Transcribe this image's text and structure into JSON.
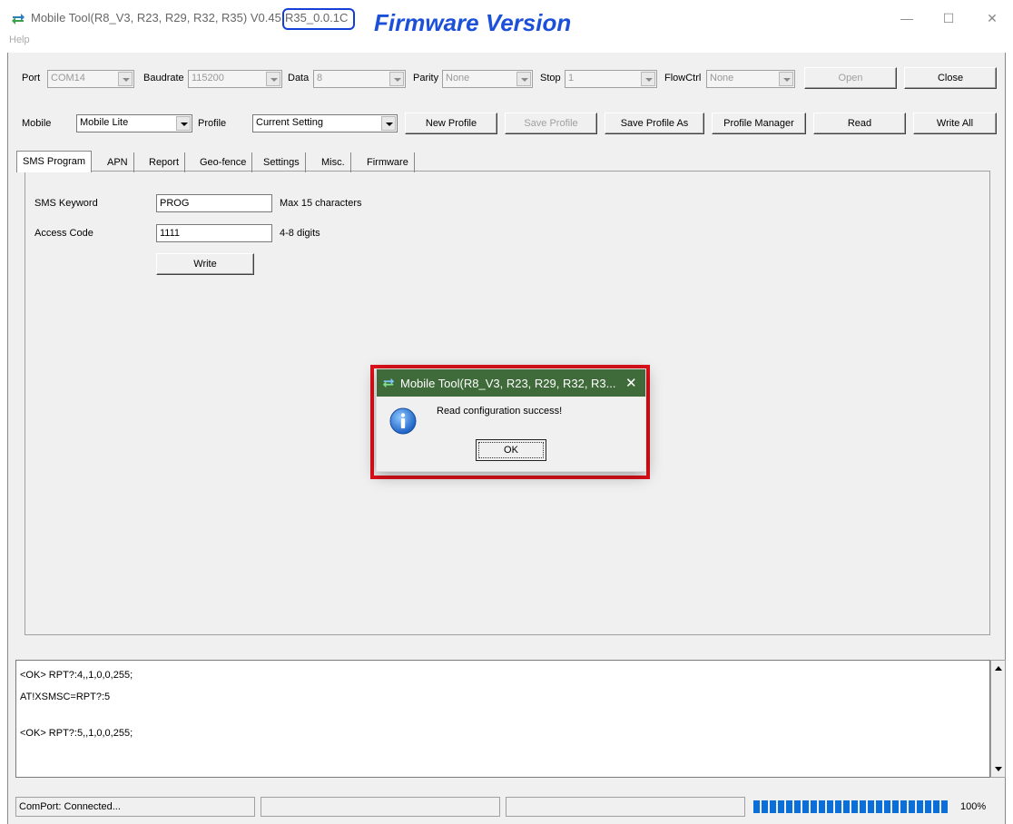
{
  "window": {
    "title": "Mobile Tool(R8_V3, R23, R29, R32, R35) V0.45",
    "firmware_version": "R35_0.0.1C",
    "annotation_label": "Firmware Version",
    "min_glyph": "—",
    "max_glyph": "☐",
    "close_glyph": "✕"
  },
  "menu": {
    "help": "Help"
  },
  "connection": {
    "port_label": "Port",
    "port_value": "COM14",
    "baudrate_label": "Baudrate",
    "baudrate_value": "115200",
    "data_label": "Data",
    "data_value": "8",
    "parity_label": "Parity",
    "parity_value": "None",
    "stop_label": "Stop",
    "stop_value": "1",
    "flowctrl_label": "FlowCtrl",
    "flowctrl_value": "None",
    "open_label": "Open",
    "close_label": "Close"
  },
  "profile_bar": {
    "mobile_label": "Mobile",
    "mobile_value": "Mobile Lite",
    "profile_label": "Profile",
    "profile_value": "Current Setting",
    "new_profile": "New Profile",
    "save_profile": "Save Profile",
    "save_profile_as": "Save Profile As",
    "profile_manager": "Profile Manager",
    "read": "Read",
    "write_all": "Write All"
  },
  "tabs": [
    {
      "label": "SMS Program"
    },
    {
      "label": "APN"
    },
    {
      "label": "Report"
    },
    {
      "label": "Geo-fence"
    },
    {
      "label": "Settings"
    },
    {
      "label": "Misc."
    },
    {
      "label": "Firmware"
    }
  ],
  "sms_program": {
    "keyword_label": "SMS Keyword",
    "keyword_value": "PROG",
    "keyword_hint": "Max 15 characters",
    "access_label": "Access Code",
    "access_value": "1111",
    "access_hint": "4-8 digits",
    "write": "Write"
  },
  "log": {
    "lines": [
      "<OK> RPT?:4,,1,0,0,255;",
      "AT!XSMSC=RPT?:5",
      "<OK> RPT?:5,,1,0,0,255;"
    ]
  },
  "status": {
    "comport": "ComPort: Connected...",
    "progress": 1.0,
    "progress_text": "100%",
    "progress_color": "#0a6fd8"
  },
  "dialog": {
    "title": "Mobile Tool(R8_V3, R23, R29, R32, R3...",
    "message": "Read configuration success!",
    "ok": "OK",
    "close_glyph": "✕",
    "icon": "info-icon",
    "titlebar_color": "#3f6b3a",
    "highlight_color": "#e0101a"
  }
}
